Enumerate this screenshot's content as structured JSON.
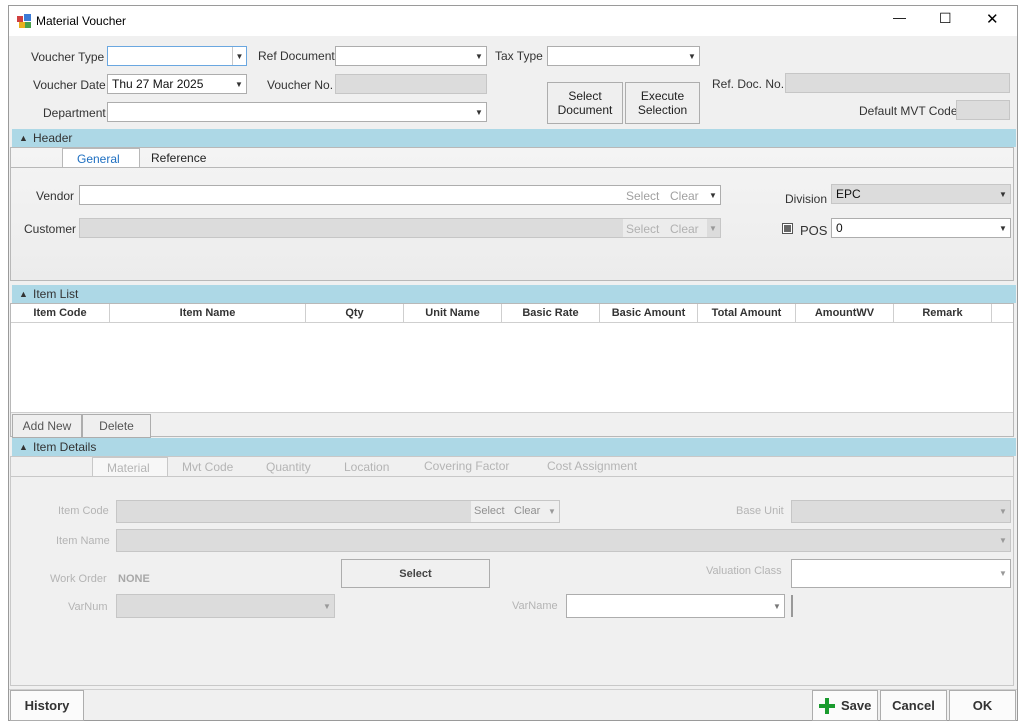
{
  "window": {
    "title": "Material Voucher",
    "minimize": "—",
    "maximize": "☐",
    "close": "✕"
  },
  "top": {
    "voucher_type_label": "Voucher Type",
    "voucher_type_value": "",
    "voucher_date_label": "Voucher Date",
    "voucher_date_value": "Thu 27 Mar 2025",
    "department_label": "Department",
    "department_value": "",
    "ref_document_label": "Ref Document",
    "ref_document_value": "",
    "voucher_no_label": "Voucher No.",
    "voucher_no_value": "",
    "tax_type_label": "Tax Type",
    "tax_type_value": "",
    "select_document_label": "Select\nDocument",
    "execute_selection_label": "Execute\nSelection",
    "ref_doc_no_label": "Ref. Doc. No.",
    "ref_doc_no_value": "",
    "default_mvt_code_label": "Default MVT Code",
    "default_mvt_code_value": ""
  },
  "header": {
    "title": "Header",
    "tabs": [
      "General",
      "Reference"
    ],
    "active_tab": "General",
    "vendor_label": "Vendor",
    "vendor_value": "",
    "customer_label": "Customer",
    "customer_value": "",
    "select_label": "Select",
    "clear_label": "Clear",
    "division_label": "Division",
    "division_value": "EPC",
    "pos_label": "POS",
    "pos_value": "0",
    "pos_checked": false
  },
  "item_list": {
    "title": "Item List",
    "columns": [
      "Item Code",
      "Item Name",
      "Qty",
      "Unit Name",
      "Basic Rate",
      "Basic Amount",
      "Total Amount",
      "AmountWV",
      "Remark"
    ],
    "rows": [],
    "add_new_label": "Add New",
    "delete_label": "Delete"
  },
  "item_details": {
    "title": "Item Details",
    "tabs": [
      "Material",
      "Mvt Code",
      "Quantity",
      "Location",
      "Covering Factor",
      "Cost Assignment"
    ],
    "active_tab": "Material",
    "item_code_label": "Item Code",
    "item_code_value": "",
    "item_name_label": "Item Name",
    "item_name_value": "",
    "work_order_label": "Work Order",
    "work_order_value": "NONE",
    "select_button_label": "Select",
    "varnum_label": "VarNum",
    "varnum_value": "",
    "base_unit_label": "Base Unit",
    "base_unit_value": "",
    "valuation_class_label": "Valuation Class",
    "valuation_class_value": "",
    "varname_label": "VarName",
    "varname_value": "",
    "select_label": "Select",
    "clear_label": "Clear"
  },
  "footer": {
    "history_label": "History",
    "save_label": "Save",
    "cancel_label": "Cancel",
    "ok_label": "OK"
  },
  "colors": {
    "section_bar": "#add8e6",
    "active_tab": "#1e6fc1",
    "save_icon": "#1a9b2e"
  }
}
